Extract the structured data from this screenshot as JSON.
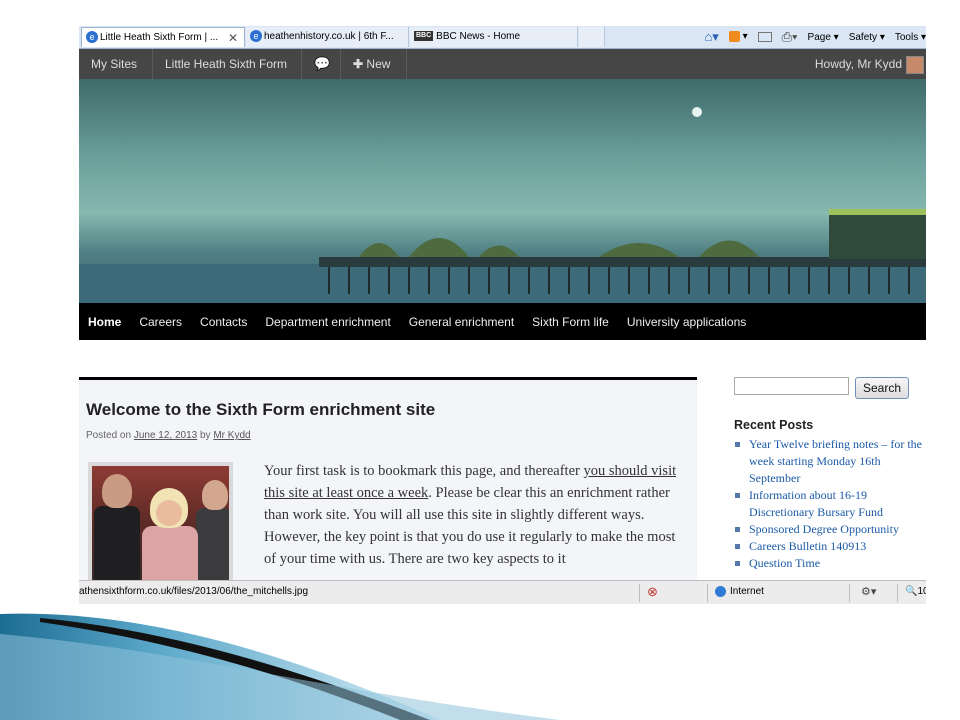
{
  "browser": {
    "tabs": [
      {
        "title": "Little Heath Sixth Form | ...",
        "active": true
      },
      {
        "title": "heathenhistory.co.uk | 6th F...",
        "active": false
      },
      {
        "title": "BBC News - Home",
        "active": false
      }
    ],
    "tab_close": "✕",
    "toolbar": {
      "page": "Page ▾",
      "safety": "Safety ▾",
      "tools": "Tools ▾"
    },
    "status": {
      "url": "athensixthform.co.uk/files/2013/06/the_mitchells.jpg",
      "zone": "Internet",
      "zoom": "10"
    }
  },
  "adminbar": {
    "my_sites": "My Sites",
    "site_name": "Little Heath Sixth Form",
    "new_label": "New",
    "howdy": "Howdy, Mr Kydd"
  },
  "nav": {
    "items": [
      "Home",
      "Careers",
      "Contacts",
      "Department enrichment",
      "General enrichment",
      "Sixth Form life",
      "University applications"
    ]
  },
  "post": {
    "title": "Welcome to the Sixth Form enrichment site",
    "posted_on": "Posted on",
    "date": "June 12, 2013",
    "by": "by",
    "author": "Mr Kydd",
    "body_1": "Your first task is to bookmark this page, and thereafter ",
    "body_link": "you should visit this site at least once a week",
    "body_2": ". Please be clear this an enrichment rather than work site. You will all use this site in slightly different ways. However, the key point is that you do use it regularly to make the most of your time with us. There are two key aspects to it"
  },
  "sidebar": {
    "search_button": "Search",
    "recent_heading": "Recent Posts",
    "recent_posts": [
      "Year Twelve briefing notes – for the week starting Monday 16th September",
      "Information about 16-19 Discretionary Bursary Fund",
      "Sponsored Degree Opportunity",
      "Careers Bulletin 140913",
      "Question Time"
    ]
  },
  "colors": {
    "adminbar_bg": "#464646",
    "nav_bg": "#000000",
    "link_blue": "#1b5aa6"
  }
}
